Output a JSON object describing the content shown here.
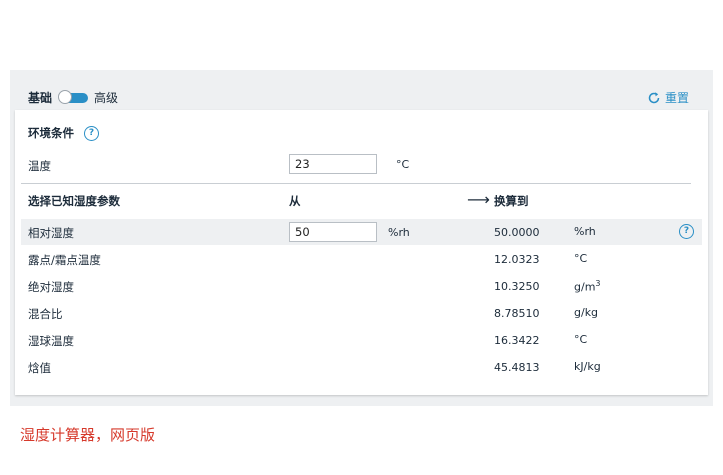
{
  "mode": {
    "basic_label": "基础",
    "advanced_label": "高级"
  },
  "reset_label": "重置",
  "conditions": {
    "title": "环境条件",
    "temperature_label": "温度",
    "temperature_value": "23",
    "temperature_unit": "°C"
  },
  "params": {
    "select_label": "选择已知湿度参数",
    "from_label": "从",
    "arrow": "⟶",
    "to_label": "换算到",
    "input_unit": "%rh",
    "rows": [
      {
        "name": "相对湿度",
        "input": "50",
        "value": "50.0000",
        "unit": "%rh"
      },
      {
        "name": "露点/霜点温度",
        "value": "12.0323",
        "unit": "°C"
      },
      {
        "name": "绝对湿度",
        "value": "10.3250",
        "unit": "g/m",
        "unit_sup": "3"
      },
      {
        "name": "混合比",
        "value": "8.78510",
        "unit": "g/kg"
      },
      {
        "name": "湿球温度",
        "value": "16.3422",
        "unit": "°C"
      },
      {
        "name": "焓值",
        "value": "45.4813",
        "unit": "kJ/kg"
      }
    ]
  },
  "help_glyph": "?",
  "caption": "湿度计算器，网页版",
  "colors": {
    "accent": "#2a8fc6",
    "caption": "#d6392b",
    "panel_bg": "#eef0f2"
  }
}
